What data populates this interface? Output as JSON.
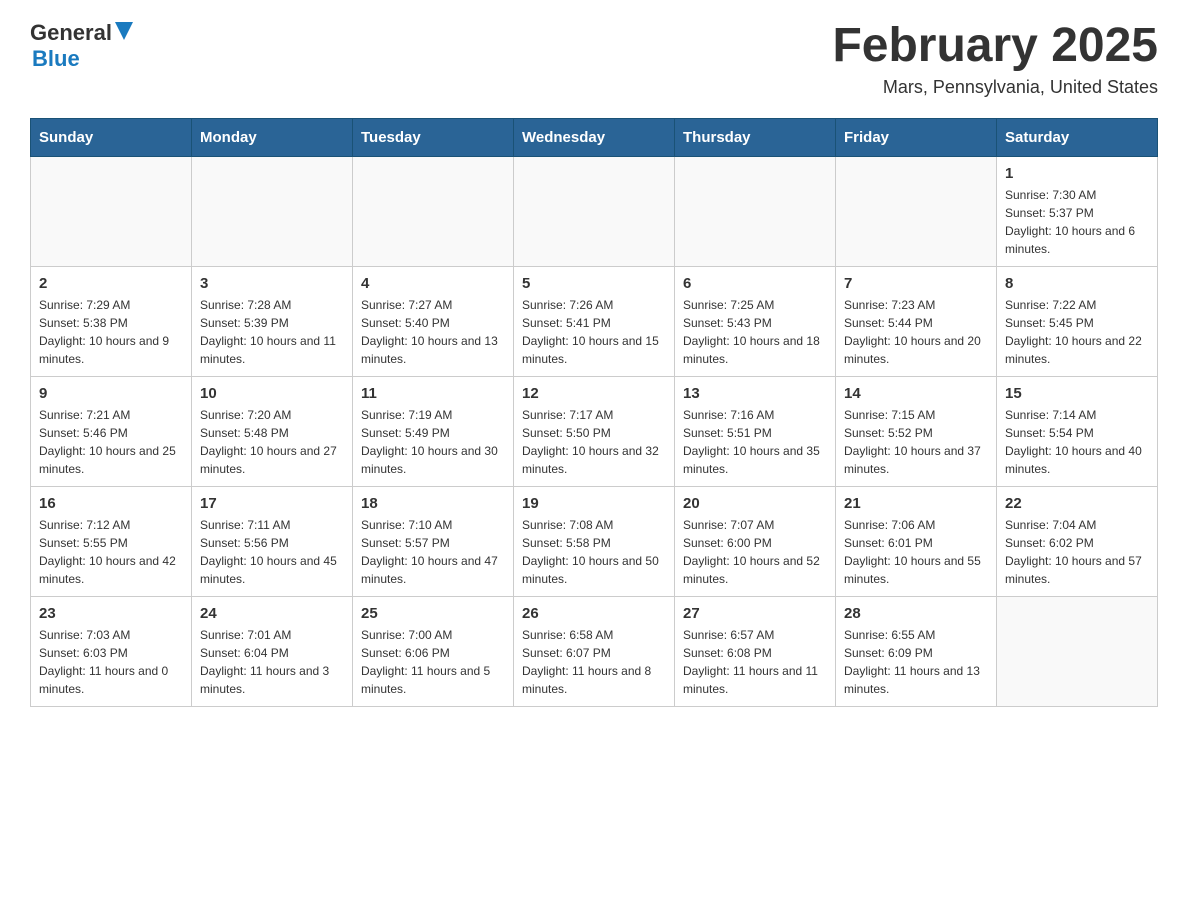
{
  "header": {
    "logo": {
      "general": "General",
      "blue": "Blue",
      "tagline": "GeneralBlue"
    },
    "title": "February 2025",
    "location": "Mars, Pennsylvania, United States"
  },
  "weekdays": [
    "Sunday",
    "Monday",
    "Tuesday",
    "Wednesday",
    "Thursday",
    "Friday",
    "Saturday"
  ],
  "weeks": [
    {
      "days": [
        {
          "number": "",
          "info": ""
        },
        {
          "number": "",
          "info": ""
        },
        {
          "number": "",
          "info": ""
        },
        {
          "number": "",
          "info": ""
        },
        {
          "number": "",
          "info": ""
        },
        {
          "number": "",
          "info": ""
        },
        {
          "number": "1",
          "info": "Sunrise: 7:30 AM\nSunset: 5:37 PM\nDaylight: 10 hours and 6 minutes."
        }
      ]
    },
    {
      "days": [
        {
          "number": "2",
          "info": "Sunrise: 7:29 AM\nSunset: 5:38 PM\nDaylight: 10 hours and 9 minutes."
        },
        {
          "number": "3",
          "info": "Sunrise: 7:28 AM\nSunset: 5:39 PM\nDaylight: 10 hours and 11 minutes."
        },
        {
          "number": "4",
          "info": "Sunrise: 7:27 AM\nSunset: 5:40 PM\nDaylight: 10 hours and 13 minutes."
        },
        {
          "number": "5",
          "info": "Sunrise: 7:26 AM\nSunset: 5:41 PM\nDaylight: 10 hours and 15 minutes."
        },
        {
          "number": "6",
          "info": "Sunrise: 7:25 AM\nSunset: 5:43 PM\nDaylight: 10 hours and 18 minutes."
        },
        {
          "number": "7",
          "info": "Sunrise: 7:23 AM\nSunset: 5:44 PM\nDaylight: 10 hours and 20 minutes."
        },
        {
          "number": "8",
          "info": "Sunrise: 7:22 AM\nSunset: 5:45 PM\nDaylight: 10 hours and 22 minutes."
        }
      ]
    },
    {
      "days": [
        {
          "number": "9",
          "info": "Sunrise: 7:21 AM\nSunset: 5:46 PM\nDaylight: 10 hours and 25 minutes."
        },
        {
          "number": "10",
          "info": "Sunrise: 7:20 AM\nSunset: 5:48 PM\nDaylight: 10 hours and 27 minutes."
        },
        {
          "number": "11",
          "info": "Sunrise: 7:19 AM\nSunset: 5:49 PM\nDaylight: 10 hours and 30 minutes."
        },
        {
          "number": "12",
          "info": "Sunrise: 7:17 AM\nSunset: 5:50 PM\nDaylight: 10 hours and 32 minutes."
        },
        {
          "number": "13",
          "info": "Sunrise: 7:16 AM\nSunset: 5:51 PM\nDaylight: 10 hours and 35 minutes."
        },
        {
          "number": "14",
          "info": "Sunrise: 7:15 AM\nSunset: 5:52 PM\nDaylight: 10 hours and 37 minutes."
        },
        {
          "number": "15",
          "info": "Sunrise: 7:14 AM\nSunset: 5:54 PM\nDaylight: 10 hours and 40 minutes."
        }
      ]
    },
    {
      "days": [
        {
          "number": "16",
          "info": "Sunrise: 7:12 AM\nSunset: 5:55 PM\nDaylight: 10 hours and 42 minutes."
        },
        {
          "number": "17",
          "info": "Sunrise: 7:11 AM\nSunset: 5:56 PM\nDaylight: 10 hours and 45 minutes."
        },
        {
          "number": "18",
          "info": "Sunrise: 7:10 AM\nSunset: 5:57 PM\nDaylight: 10 hours and 47 minutes."
        },
        {
          "number": "19",
          "info": "Sunrise: 7:08 AM\nSunset: 5:58 PM\nDaylight: 10 hours and 50 minutes."
        },
        {
          "number": "20",
          "info": "Sunrise: 7:07 AM\nSunset: 6:00 PM\nDaylight: 10 hours and 52 minutes."
        },
        {
          "number": "21",
          "info": "Sunrise: 7:06 AM\nSunset: 6:01 PM\nDaylight: 10 hours and 55 minutes."
        },
        {
          "number": "22",
          "info": "Sunrise: 7:04 AM\nSunset: 6:02 PM\nDaylight: 10 hours and 57 minutes."
        }
      ]
    },
    {
      "days": [
        {
          "number": "23",
          "info": "Sunrise: 7:03 AM\nSunset: 6:03 PM\nDaylight: 11 hours and 0 minutes."
        },
        {
          "number": "24",
          "info": "Sunrise: 7:01 AM\nSunset: 6:04 PM\nDaylight: 11 hours and 3 minutes."
        },
        {
          "number": "25",
          "info": "Sunrise: 7:00 AM\nSunset: 6:06 PM\nDaylight: 11 hours and 5 minutes."
        },
        {
          "number": "26",
          "info": "Sunrise: 6:58 AM\nSunset: 6:07 PM\nDaylight: 11 hours and 8 minutes."
        },
        {
          "number": "27",
          "info": "Sunrise: 6:57 AM\nSunset: 6:08 PM\nDaylight: 11 hours and 11 minutes."
        },
        {
          "number": "28",
          "info": "Sunrise: 6:55 AM\nSunset: 6:09 PM\nDaylight: 11 hours and 13 minutes."
        },
        {
          "number": "",
          "info": ""
        }
      ]
    }
  ]
}
